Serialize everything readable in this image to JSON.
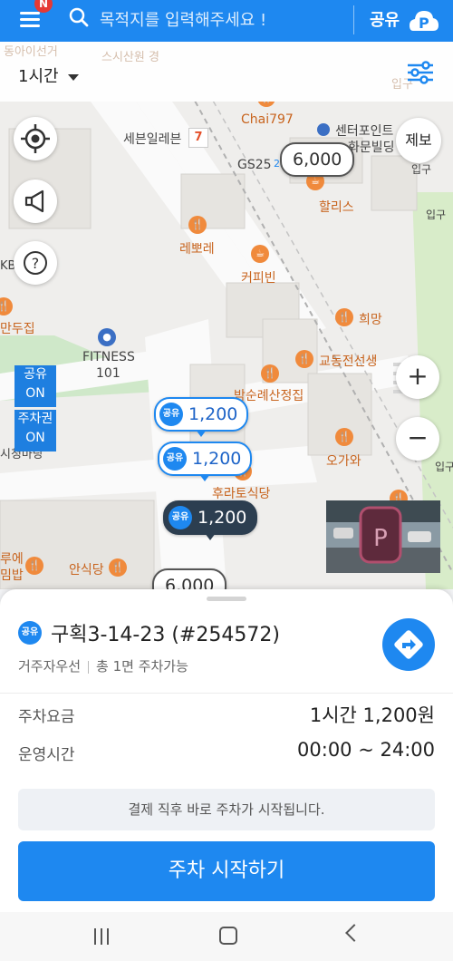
{
  "topbar": {
    "badge": "N",
    "search_placeholder": "목적지를 입력해주세요 !",
    "share_label": "공유"
  },
  "filter": {
    "time_value": "1시간",
    "faded_top_left": "동아이선거",
    "faded_sushi": "스시산원 경",
    "faded_right": "입구"
  },
  "map": {
    "report_label": "제보",
    "zoom_in": "+",
    "zoom_out": "−",
    "toggle": {
      "share": "공유",
      "share_state": "ON",
      "ticket": "주차권",
      "ticket_state": "ON"
    },
    "pois": {
      "chai797": "Chai797",
      "seven_eleven": "세븐일레븐",
      "seven_eleven_badge": "7",
      "center_point": "센터포인트",
      "hwamun": "화문빌딩",
      "gs25": "GS25",
      "gs25_partial": "25",
      "hollys": "할리스",
      "entrance_1": "입구",
      "entrance_2": "입구",
      "entrance_3": "입구",
      "lebbure": "레뽀레",
      "coffee_bean": "커피빈",
      "kb": "KB",
      "mandu": "만두집",
      "hope": "희망",
      "fitness": "FITNESS",
      "fitness_num": "101",
      "kyodong": "교동전선생",
      "park_soonrye": "박순례산정집",
      "okawa": "오가와",
      "siseong": "시청마당",
      "hurato": "후라토식당",
      "rue": "루에",
      "bimbap": "밈밥",
      "ansikdang": "안식당"
    },
    "pins": [
      {
        "badge": "공유",
        "price": "1,200"
      },
      {
        "badge": "공유",
        "price": "1,200"
      },
      {
        "badge": "공유",
        "price": "1,200"
      }
    ],
    "plain_pins": [
      "6,000",
      "6,000"
    ]
  },
  "sheet": {
    "badge": "공유",
    "title": "구획3-14-23 (#254572)",
    "category": "거주자우선",
    "capacity": "총 1면 주차가능",
    "fee_label": "주차요금",
    "fee_value": "1시간 1,200원",
    "hours_label": "운영시간",
    "hours_value": "00:00 ~ 24:00",
    "notice": "결제 직후 바로 주차가 시작됩니다.",
    "start_button": "주차 시작하기"
  },
  "icons": {
    "menu": "menu-icon",
    "search": "search-icon",
    "share_logo": "share-parking-logo-icon",
    "filter": "filter-sliders-icon",
    "locate": "crosshair-location-icon",
    "megaphone": "megaphone-icon",
    "help": "question-icon",
    "navigate": "directions-icon"
  },
  "colors": {
    "brand_blue": "#1e88f0",
    "poi_orange": "#c8641e",
    "selected_pin": "#2c3e50"
  }
}
